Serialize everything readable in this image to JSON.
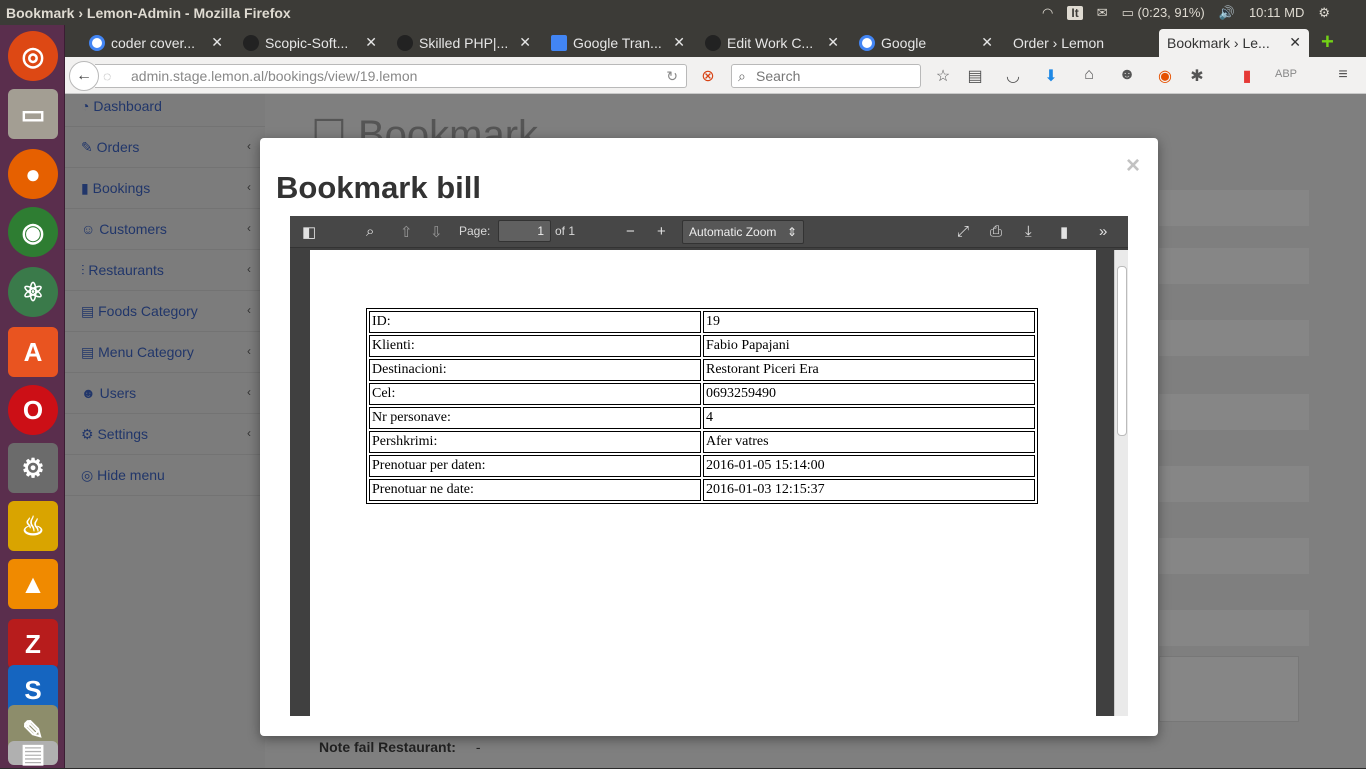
{
  "ubuntu_panel": {
    "window_title": "Bookmark › Lemon-Admin - Mozilla Firefox",
    "keyboard": "It",
    "battery": "(0:23, 91%)",
    "clock": "10:11 MD"
  },
  "browser": {
    "tabs": [
      {
        "label": "coder cover...",
        "icon": "google-icon"
      },
      {
        "label": "Scopic-Soft...",
        "icon": "upwork-icon"
      },
      {
        "label": "Skilled PHP|...",
        "icon": "upwork-icon"
      },
      {
        "label": "Google Tran...",
        "icon": "translate-icon"
      },
      {
        "label": "Edit Work C...",
        "icon": "upwork-icon"
      },
      {
        "label": "Google",
        "icon": "google-icon"
      },
      {
        "label": "Order › Lemon",
        "icon": ""
      },
      {
        "label": "Bookmark › Le...",
        "icon": "",
        "active": true
      }
    ],
    "url": "admin.stage.lemon.al/bookings/view/19.lemon",
    "search_placeholder": "Search"
  },
  "sidebar": {
    "items": [
      {
        "label": "Dashboard",
        "icon": "dashboard-icon"
      },
      {
        "label": "Orders",
        "icon": "pin-icon"
      },
      {
        "label": "Bookings",
        "icon": "bookmark-icon"
      },
      {
        "label": "Customers",
        "icon": "users-icon"
      },
      {
        "label": "Restaurants",
        "icon": "cutlery-icon"
      },
      {
        "label": "Foods Category",
        "icon": "list-icon"
      },
      {
        "label": "Menu Category",
        "icon": "list-icon"
      },
      {
        "label": "Users",
        "icon": "user-icon"
      },
      {
        "label": "Settings",
        "icon": "gears-icon"
      },
      {
        "label": "Hide menu",
        "icon": "eye-slash-icon"
      }
    ]
  },
  "background_page": {
    "heading": "Bookmark",
    "note_label": "Note fail Restaurant:",
    "note_value": "-"
  },
  "modal": {
    "title": "Bookmark bill",
    "close": "×"
  },
  "pdf_viewer": {
    "page_label": "Page:",
    "page_value": "1",
    "page_total": "of 1",
    "zoom": "Automatic Zoom"
  },
  "bill": {
    "rows": [
      {
        "label": "ID:",
        "value": "19"
      },
      {
        "label": "Klienti:",
        "value": "Fabio Papajani"
      },
      {
        "label": "Destinacioni:",
        "value": "Restorant Piceri Era"
      },
      {
        "label": "Cel:",
        "value": "0693259490"
      },
      {
        "label": "Nr personave:",
        "value": "4"
      },
      {
        "label": "Pershkrimi:",
        "value": "Afer vatres"
      },
      {
        "label": "Prenotuar per daten:",
        "value": "2016-01-05 15:14:00"
      },
      {
        "label": "Prenotuar ne date:",
        "value": "2016-01-03 12:15:37"
      }
    ]
  }
}
